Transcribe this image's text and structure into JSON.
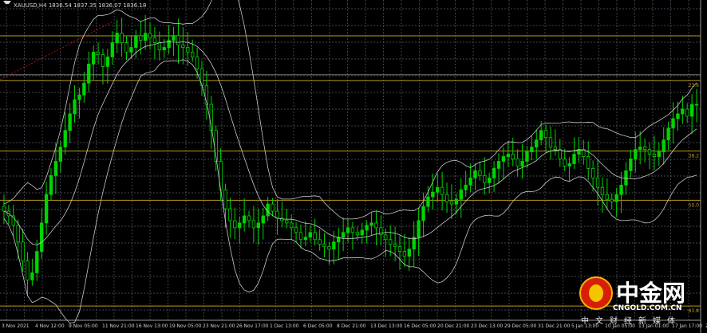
{
  "header": {
    "text": "XAUUSD,H4  1836.54 1837.35 1836.07 1836.18"
  },
  "watermark": {
    "brand": "中金网",
    "url": "CNGOLD.COM.CN",
    "subtitle": "中文财经新媒体"
  },
  "colors": {
    "background": "#000000",
    "grid": "#5a5a6e",
    "bull_candle": "#00d400",
    "bear_candle": "#00d400",
    "bands": "#c8c8c8",
    "fib_lines": "#b89a18",
    "trend_line": "#b41414",
    "logo_red": "#d81e06",
    "logo_gold": "#f5c400"
  },
  "chart_data": {
    "type": "candlestick",
    "symbol": "XAUUSD",
    "timeframe": "H4",
    "price_axis": "hidden",
    "grid": true,
    "x_tick_labels": [
      "3 Nov 2021",
      "4 Nov 12:00",
      "9 Nov 05:00",
      "11 Nov 21:00",
      "16 Nov 13:00",
      "19 Nov 05:00",
      "23 Nov 21:00",
      "26 Nov 17:00",
      "1 Dec 13:00",
      "6 Dec 05:00",
      "8 Dec 21:00",
      "13 Dec 13:00",
      "16 Dec 05:00",
      "20 Dec 21:00",
      "23 Dec 13:00",
      "29 Dec 05:00",
      "31 Dec 21:00",
      "5 Jan 13:00",
      "10 Jan 05:00",
      "13 Jan 01:00",
      "17 Jan 17:00",
      "20 Jan 09:00"
    ],
    "fibonacci_levels": [
      {
        "label": "23.6",
        "level_index": 1
      },
      {
        "label": "38.2",
        "level_index": 2
      },
      {
        "label": "50.0",
        "level_index": 3
      },
      {
        "label": "61.8",
        "level_index": 4
      }
    ],
    "close_series": [
      1791,
      1789,
      1785,
      1778,
      1770,
      1762,
      1765,
      1774,
      1786,
      1798,
      1806,
      1812,
      1818,
      1825,
      1832,
      1838,
      1840,
      1845,
      1853,
      1858,
      1857,
      1852,
      1856,
      1862,
      1866,
      1862,
      1858,
      1860,
      1865,
      1863,
      1866,
      1864,
      1862,
      1859,
      1860,
      1863,
      1865,
      1861,
      1860,
      1858,
      1856,
      1851,
      1844,
      1836,
      1825,
      1812,
      1800,
      1792,
      1787,
      1784,
      1786,
      1789,
      1787,
      1784,
      1786,
      1789,
      1794,
      1791,
      1788,
      1787,
      1786,
      1784,
      1782,
      1779,
      1780,
      1782,
      1779,
      1777,
      1776,
      1775,
      1778,
      1780,
      1782,
      1784,
      1782,
      1781,
      1783,
      1785,
      1786,
      1784,
      1781,
      1779,
      1777,
      1776,
      1774,
      1772,
      1775,
      1780,
      1787,
      1793,
      1797,
      1799,
      1801,
      1798,
      1795,
      1794,
      1796,
      1800,
      1802,
      1805,
      1808,
      1806,
      1803,
      1805,
      1809,
      1812,
      1814,
      1815,
      1813,
      1810,
      1812,
      1816,
      1818,
      1821,
      1825,
      1822,
      1818,
      1817,
      1813,
      1810,
      1811,
      1815,
      1817,
      1814,
      1809,
      1805,
      1801,
      1798,
      1796,
      1795,
      1798,
      1802,
      1808,
      1813,
      1817,
      1818,
      1817,
      1815,
      1814,
      1816,
      1821,
      1826,
      1830,
      1832,
      1834,
      1831,
      1836,
      1836
    ]
  }
}
